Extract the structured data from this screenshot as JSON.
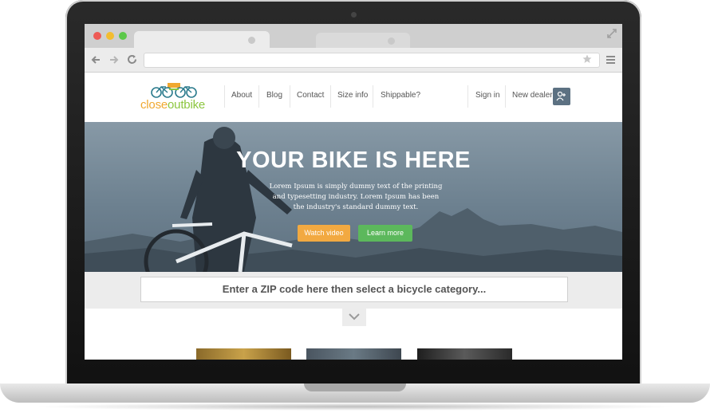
{
  "site": {
    "logo": {
      "part1": "close",
      "part2": "out",
      "part3": "bike"
    },
    "nav": [
      {
        "label": "About"
      },
      {
        "label": "Blog"
      },
      {
        "label": "Contact"
      },
      {
        "label": "Size info"
      },
      {
        "label": "Shippable?"
      }
    ],
    "account": {
      "sign_in": "Sign in",
      "new_dealer": "New dealer"
    }
  },
  "hero": {
    "title": "YOUR BIKE IS HERE",
    "text": "Lorem Ipsum is simply dummy text of the printing and typesetting industry. Lorem Ipsum has been the industry's standard dummy text.",
    "watch_video": "Watch video",
    "learn_more": "Learn more"
  },
  "search": {
    "placeholder": "Enter a ZIP code here then select a bicycle category..."
  },
  "colors": {
    "accent_orange": "#f2a941",
    "accent_green": "#5cb85c",
    "logo_green": "#8cc63f",
    "logo_orange": "#f0a830",
    "logo_teal": "#2a7a8c"
  }
}
